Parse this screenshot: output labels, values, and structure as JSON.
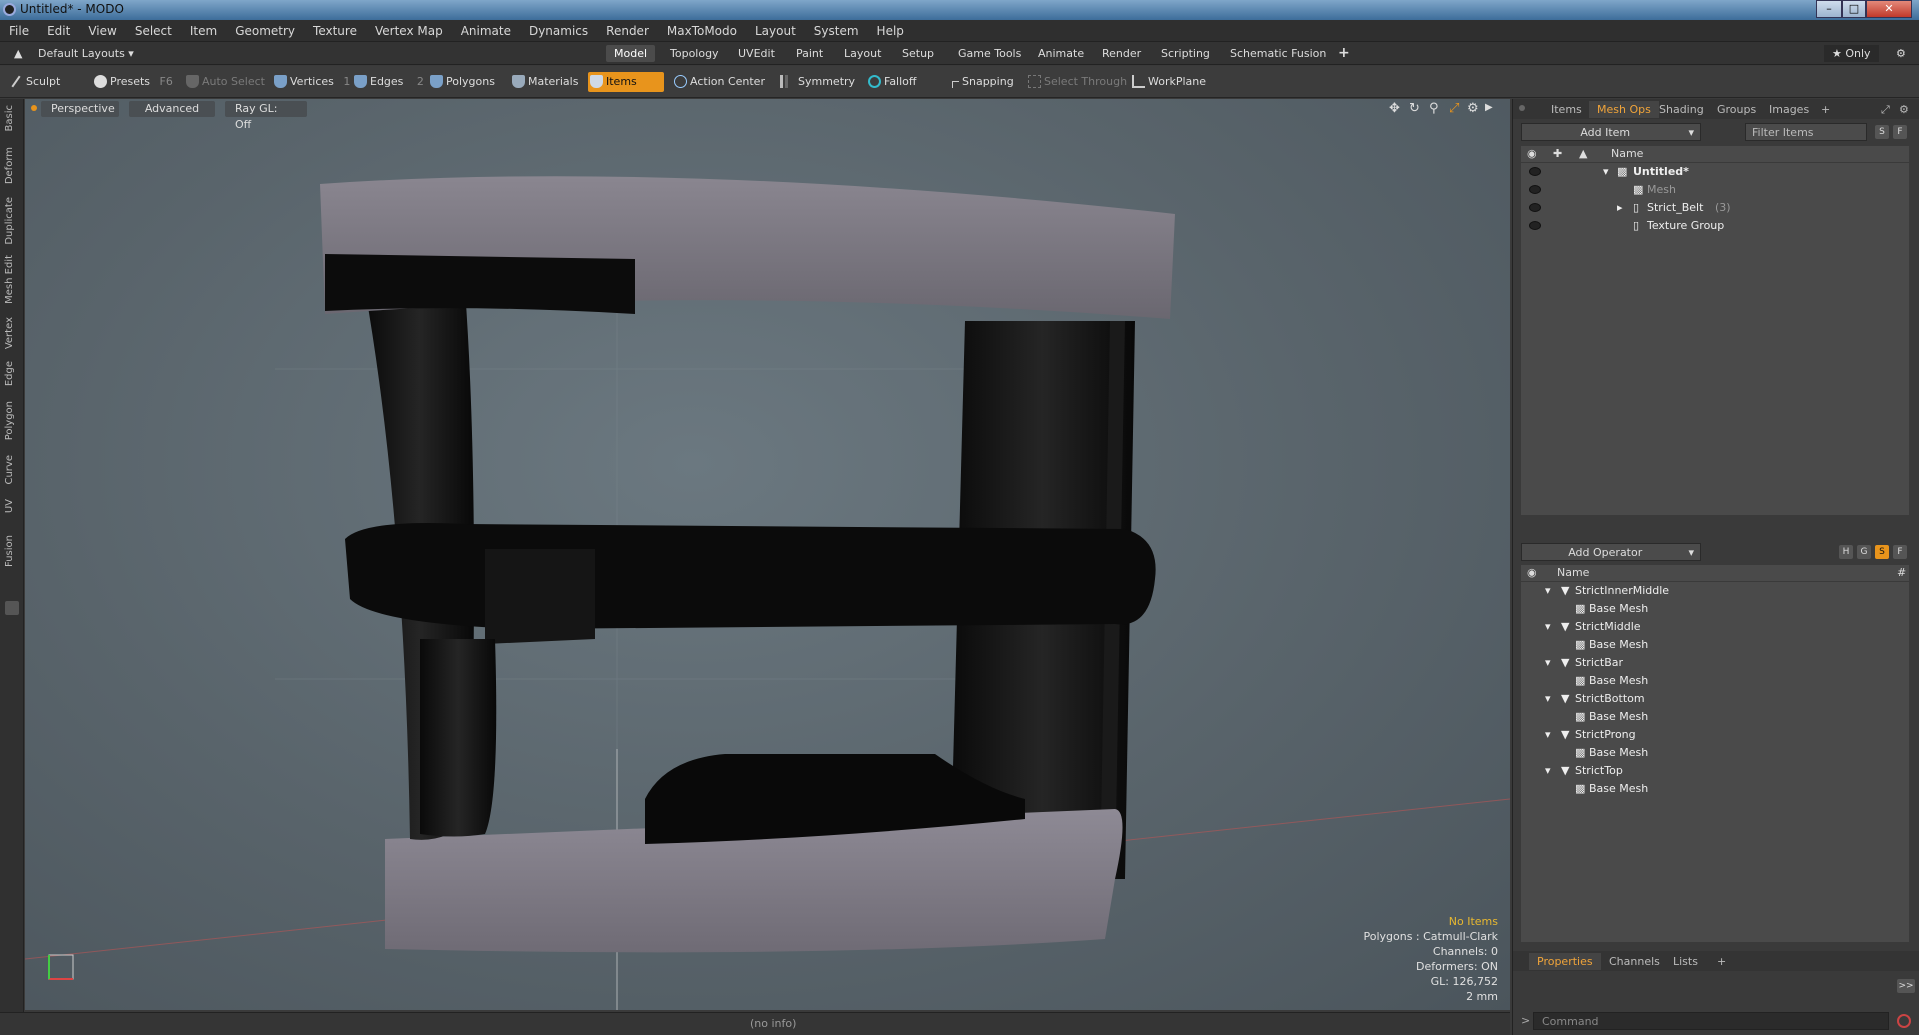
{
  "window": {
    "title": "Untitled* - MODO",
    "minimize": "–",
    "maximize": "□",
    "close": "✕"
  },
  "menu": [
    "File",
    "Edit",
    "View",
    "Select",
    "Item",
    "Geometry",
    "Texture",
    "Vertex Map",
    "Animate",
    "Dynamics",
    "Render",
    "MaxToModo",
    "Layout",
    "System",
    "Help"
  ],
  "layoutbar": {
    "layout_selector": "Default Layouts ▾",
    "tabs": [
      "Model",
      "Topology",
      "UVEdit",
      "Paint",
      "Layout",
      "Setup",
      "Game Tools",
      "Animate",
      "Render",
      "Scripting",
      "Schematic Fusion"
    ],
    "active_tab": "Model",
    "add": "+",
    "only": "★  Only"
  },
  "toolbar": {
    "sculpt": "Sculpt",
    "presets": "Presets",
    "presets_key": "F6",
    "auto_select": "Auto Select",
    "vertices": "Vertices",
    "vertices_count": "1",
    "edges": "Edges",
    "edges_count": "2",
    "polygons": "Polygons",
    "materials": "Materials",
    "items": "Items",
    "action_center": "Action Center",
    "symmetry": "Symmetry",
    "falloff": "Falloff",
    "snapping": "Snapping",
    "select_through": "Select Through",
    "workplane": "WorkPlane"
  },
  "left_tabs": [
    "Basic",
    "Deform",
    "Duplicate",
    "Mesh Edit",
    "Vertex",
    "Edge",
    "Polygon",
    "Curve",
    "UV",
    "Fusion"
  ],
  "viewport": {
    "view": "Perspective",
    "mode": "Advanced",
    "raygl": "Ray GL: Off",
    "stats": {
      "no_items": "No Items",
      "polygons": "Polygons : Catmull-Clark",
      "channels": "Channels: 0",
      "deformers": "Deformers: ON",
      "gl": "GL: 126,752",
      "scale": "2 mm"
    }
  },
  "status": {
    "info": "(no info)"
  },
  "items_panel": {
    "tabs": [
      "Items",
      "Mesh Ops",
      "Shading",
      "Groups",
      "Images"
    ],
    "active_tab": "Mesh Ops",
    "add_item": "Add Item",
    "filter_placeholder": "Filter Items",
    "btn_s": "S",
    "btn_f": "F",
    "col_name": "Name",
    "tree": [
      {
        "label": "Untitled*",
        "indent": 0
      },
      {
        "label": "Mesh",
        "indent": 1
      },
      {
        "label": "Strict_Belt",
        "count": "(3)",
        "indent": 1
      },
      {
        "label": "Texture Group",
        "indent": 1
      }
    ]
  },
  "operator_panel": {
    "add_operator": "Add Operator",
    "btn_h": "H",
    "btn_g": "G",
    "btn_s": "S",
    "btn_f": "F",
    "col_name": "Name",
    "col_hash": "#",
    "tree": [
      {
        "label": "StrictInnerMiddle",
        "child": "Base Mesh"
      },
      {
        "label": "StrictMiddle",
        "child": "Base Mesh"
      },
      {
        "label": "StrictBar",
        "child": "Base Mesh"
      },
      {
        "label": "StrictBottom",
        "child": "Base Mesh"
      },
      {
        "label": "StrictProng",
        "child": "Base Mesh"
      },
      {
        "label": "StrictTop",
        "child": "Base Mesh"
      }
    ]
  },
  "properties_panel": {
    "tabs": [
      "Properties",
      "Channels",
      "Lists"
    ],
    "active_tab": "Properties",
    "add": "+",
    "expand": ">>"
  },
  "command": {
    "placeholder": "Command"
  }
}
